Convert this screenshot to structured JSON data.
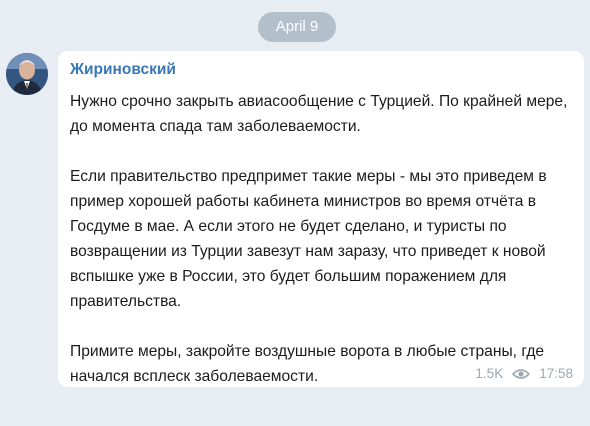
{
  "date_separator": "April 9",
  "message": {
    "sender": "Жириновский",
    "paragraphs": [
      "Нужно срочно закрыть авиасообщение с Турцией. По крайней мере, до момента спада там заболеваемости.",
      "Если правительство предпримет такие меры - мы это приведем в пример хорошей работы кабинета министров во время отчёта в Госдуме в мае. А если этого не будет сделано, и туристы по возвращении из Турции завезут нам заразу, что приведет к новой вспышке уже в России, это будет большим поражением для правительства.",
      "Примите меры, закройте воздушные ворота в любые страны, где начался всплеск заболеваемости."
    ],
    "views": "1.5K",
    "views_icon": "eye-icon",
    "time": "17:58"
  },
  "colors": {
    "background": "#e8edf3",
    "date_pill": "#b4bfcc",
    "sender_name": "#3a78b5",
    "meta_text": "#9ea7b1"
  }
}
